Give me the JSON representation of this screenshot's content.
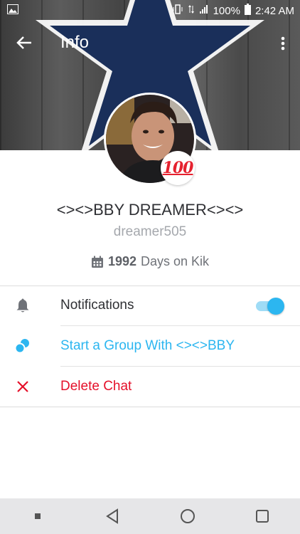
{
  "status_bar": {
    "battery": "100%",
    "time": "2:42 AM",
    "icons": [
      "image-icon",
      "vibrate-icon",
      "lte-icon",
      "signal-icon",
      "battery-icon"
    ]
  },
  "app_bar": {
    "title": "Info",
    "back_icon": "arrow-left-icon",
    "more_icon": "more-vertical-icon"
  },
  "profile": {
    "badge_emoji": "100",
    "display_name": "<><>BBY DREAMER<><>",
    "username": "dreamer505",
    "days_count": "1992",
    "days_suffix": "Days on Kik"
  },
  "settings": [
    {
      "label": "Notifications",
      "icon": "bell-icon",
      "toggle_on": true
    },
    {
      "label": "Start a Group With <><>BBY",
      "icon": "group-icon"
    },
    {
      "label": "Delete Chat",
      "icon": "close-icon"
    }
  ],
  "colors": {
    "accent": "#2cb6f0",
    "danger": "#e5102a",
    "cover_star": "#1a2f5a"
  },
  "nav_bar": [
    "square-small-icon",
    "back-triangle-icon",
    "home-circle-icon",
    "recents-square-icon"
  ]
}
